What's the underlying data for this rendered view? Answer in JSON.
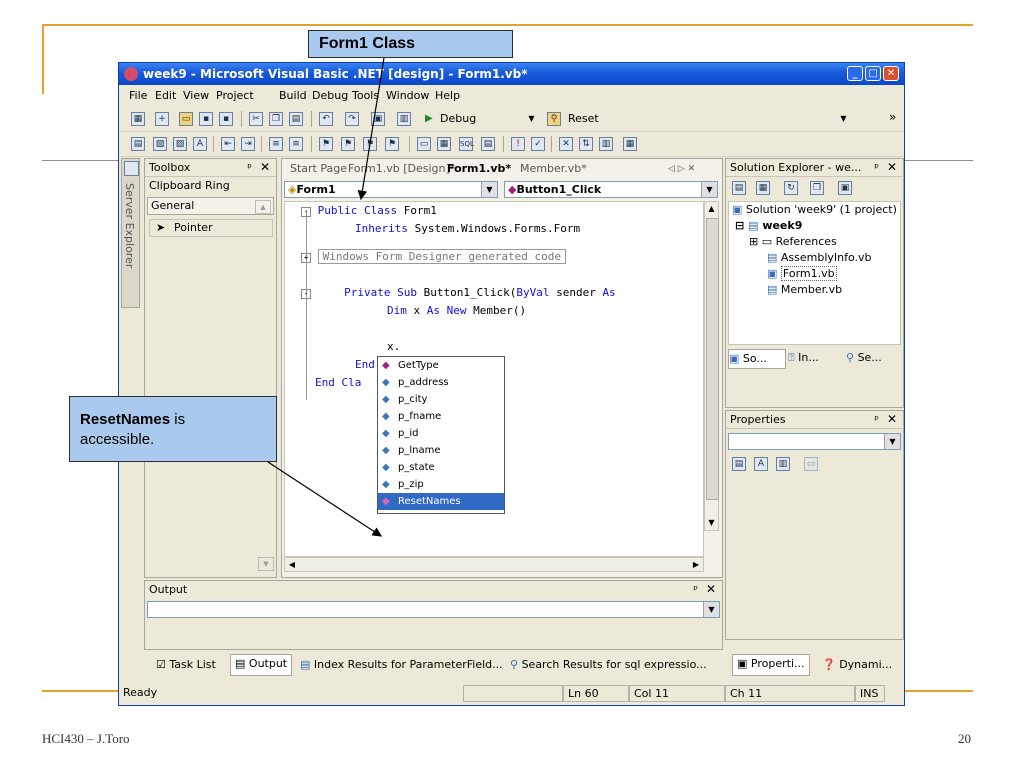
{
  "colors": {
    "accent_rule": "#e3a230",
    "callout_fill": "#a9c9ee",
    "titlebar": "#0a47c9",
    "keyword": "#1010d8"
  },
  "callouts": {
    "form1": "Form1 Class",
    "resetnames_bold": "ResetNames",
    "resetnames_rest": " is",
    "resetnames_line2": "accessible."
  },
  "window": {
    "title": "week9 - Microsoft Visual Basic .NET [design] - Form1.vb*",
    "app_icon": "vs-icon",
    "controls": {
      "minimize": "minimize-icon",
      "maximize": "maximize-icon",
      "close": "close-icon"
    }
  },
  "menu": [
    "File",
    "Edit",
    "View",
    "Project",
    "Build",
    "Debug",
    "Tools",
    "Window",
    "Help"
  ],
  "toolbar": {
    "config": "Debug",
    "find": "Reset",
    "more": "»"
  },
  "toolbox": {
    "title": "Toolbox",
    "tabs": [
      "Clipboard Ring",
      "General"
    ],
    "items": [
      "Pointer"
    ],
    "side_tab": "Server Explorer"
  },
  "editor": {
    "tabs": [
      "Start Page",
      "Form1.vb [Design]*",
      "Form1.vb*",
      "Member.vb*"
    ],
    "class_combo": "Form1",
    "method_combo": "Button1_Click",
    "nav": "◁ ▷ ✕",
    "code": {
      "l1_kw": "Public Class",
      "l1_rest": " Form1",
      "l2_kw": "Inherits",
      "l2_rest": " System.Windows.Forms.Form",
      "region": "Windows Form Designer generated code",
      "l4_kw": "Private Sub",
      "l4_rest": " Button1_Click(",
      "l4_kw2": "ByVal",
      "l4_rest2": " sender ",
      "l4_kw3": "As",
      "l5_kw": "Dim",
      "l5_mid": " x ",
      "l5_kw2": "As New",
      "l5_rest": " Member()",
      "l6": "x.",
      "l7": "End",
      "l8": "End Cla"
    }
  },
  "intellisense": {
    "items": [
      "GetType",
      "p_address",
      "p_city",
      "p_fname",
      "p_id",
      "p_lname",
      "p_state",
      "p_zip",
      "ResetNames"
    ],
    "selected": "ResetNames"
  },
  "solution_explorer": {
    "title": "Solution Explorer - we...",
    "solution": "Solution 'week9' (1 project)",
    "project": "week9",
    "nodes": [
      "References",
      "AssemblyInfo.vb",
      "Form1.vb",
      "Member.vb"
    ],
    "tabs": [
      "So...",
      "In...",
      "Se..."
    ]
  },
  "properties": {
    "title": "Properties"
  },
  "output": {
    "title": "Output"
  },
  "bottom_tabs": [
    "Task List",
    "Output",
    "Index Results for ParameterField...",
    "Search Results for sql expressio...",
    "Properti...",
    "Dynami..."
  ],
  "status": {
    "text": "Ready",
    "ln": "Ln 60",
    "col": "Col 11",
    "ch": "Ch 11",
    "ins": "INS"
  },
  "footer": {
    "left": "HCI430 – J.Toro",
    "page": "20"
  }
}
